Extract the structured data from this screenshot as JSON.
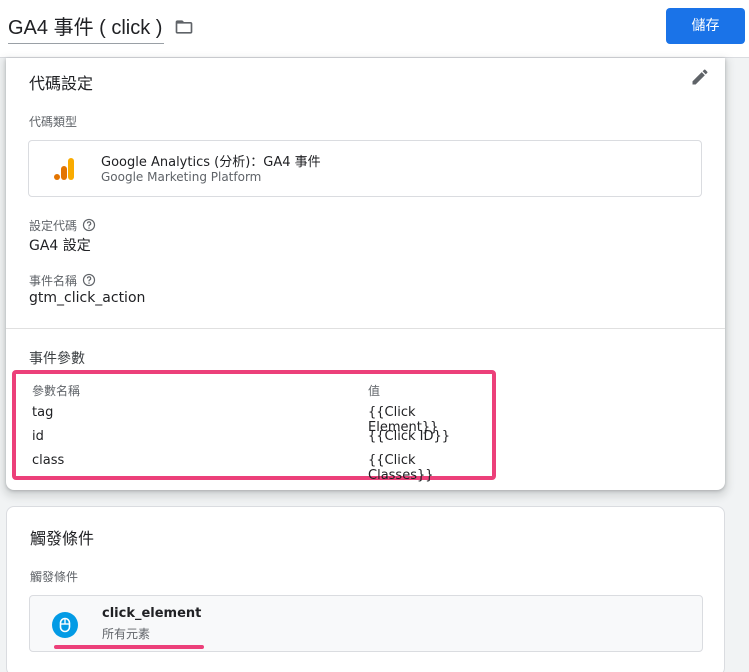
{
  "header": {
    "tag_name": "GA4 事件 ( click )",
    "save_label": "儲存"
  },
  "config": {
    "title": "代碼設定",
    "tag_type_label": "代碼類型",
    "tag_type_name": "Google Analytics (分析)：GA4 事件",
    "tag_type_platform": "Google Marketing Platform",
    "config_tag_label": "設定代碼",
    "config_tag_value": "GA4 設定",
    "event_name_label": "事件名稱",
    "event_name_value": "gtm_click_action",
    "event_params_label": "事件參數",
    "params_header": {
      "name": "參數名稱",
      "value": "值"
    },
    "params": [
      {
        "name": "tag",
        "value": "{{Click Element}}"
      },
      {
        "name": "id",
        "value": "{{Click ID}}"
      },
      {
        "name": "class",
        "value": "{{Click Classes}}"
      }
    ]
  },
  "triggering": {
    "title": "觸發條件",
    "label": "觸發條件",
    "trigger_name": "click_element",
    "trigger_type": "所有元素"
  },
  "colors": {
    "accent": "#1a73e8",
    "highlight": "#ec407a",
    "ga_orange": "#f9ab00",
    "ga_dark_orange": "#e37400",
    "trigger_blue": "#039be5"
  },
  "icons": {
    "folder": "folder-icon",
    "edit": "pencil-icon",
    "help": "help-icon",
    "analytics": "google-analytics-icon",
    "trigger": "mouse-icon"
  }
}
